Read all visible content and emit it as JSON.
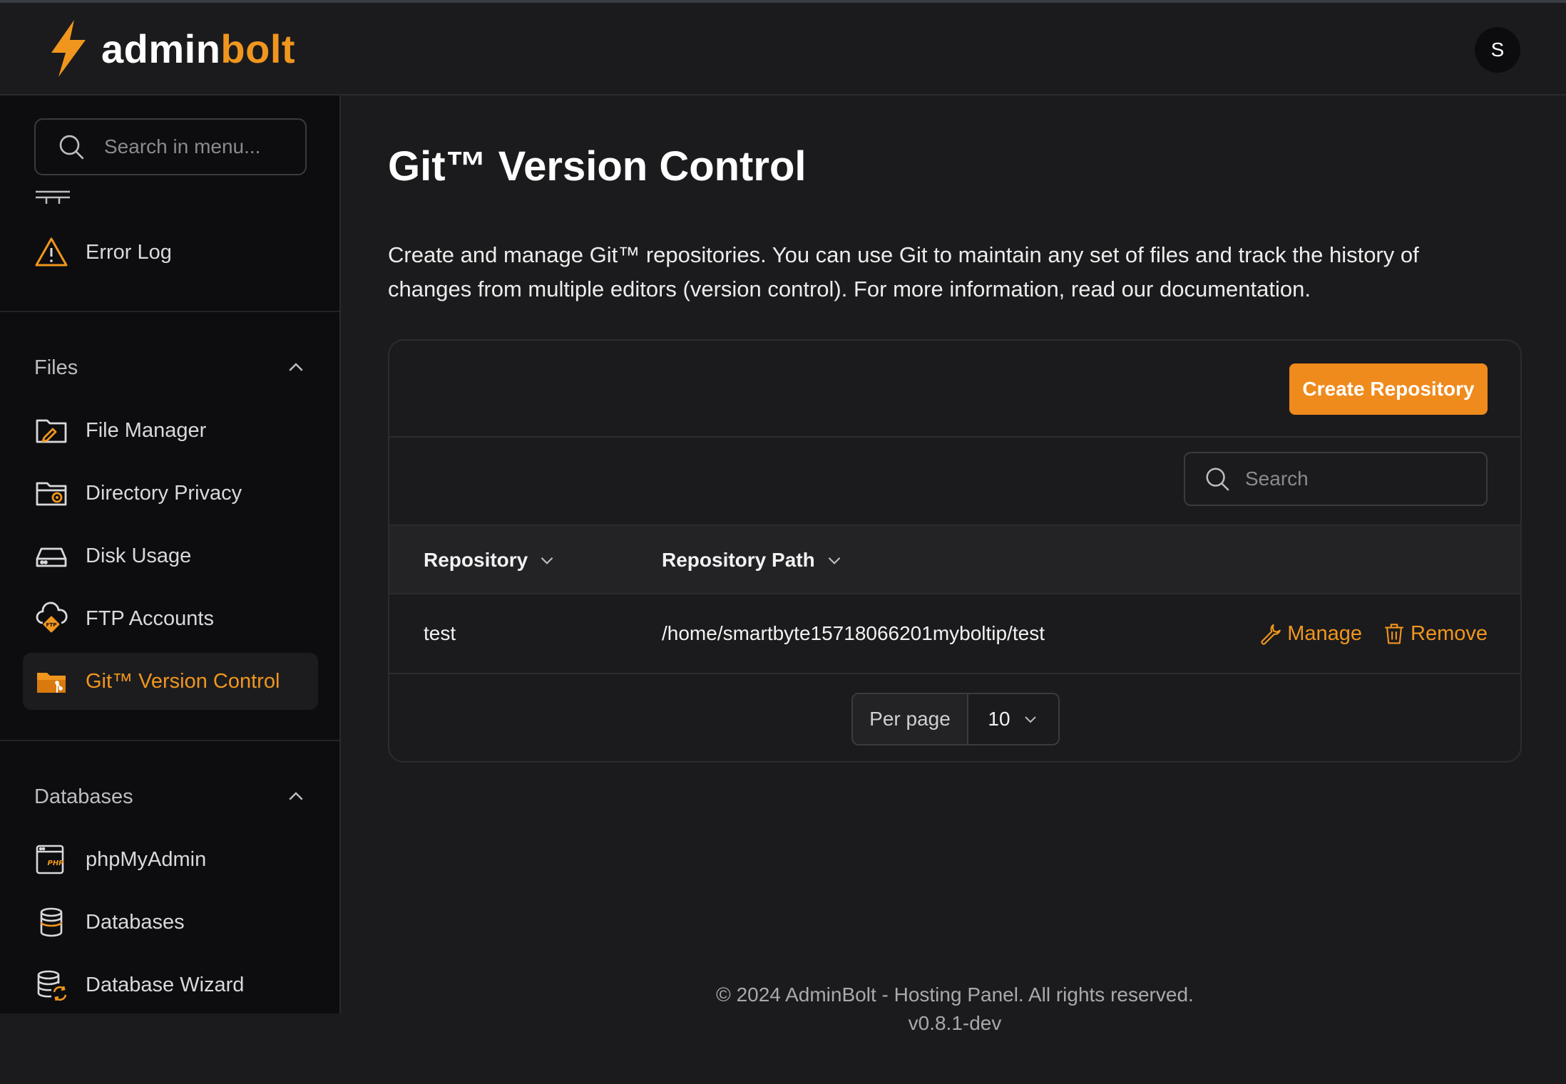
{
  "header": {
    "logo_part1": "admin",
    "logo_part2": "bolt",
    "avatar_initial": "S",
    "brand_color": "#f0961e"
  },
  "sidebar": {
    "search_placeholder": "Search in menu...",
    "top_items": [
      {
        "label": "Error Log",
        "icon": "warning-icon"
      }
    ],
    "sections": [
      {
        "title": "Files",
        "expanded": true,
        "items": [
          {
            "label": "File Manager",
            "icon": "file-manager-icon"
          },
          {
            "label": "Directory Privacy",
            "icon": "directory-privacy-icon"
          },
          {
            "label": "Disk Usage",
            "icon": "disk-usage-icon"
          },
          {
            "label": "FTP Accounts",
            "icon": "ftp-accounts-icon"
          },
          {
            "label": "Git™ Version Control",
            "icon": "git-folder-icon",
            "active": true
          }
        ]
      },
      {
        "title": "Databases",
        "expanded": true,
        "items": [
          {
            "label": "phpMyAdmin",
            "icon": "phpmyadmin-icon"
          },
          {
            "label": "Databases",
            "icon": "database-icon"
          },
          {
            "label": "Database Wizard",
            "icon": "database-wizard-icon"
          }
        ]
      }
    ]
  },
  "main": {
    "title": "Git™ Version Control",
    "description": "Create and manage Git™ repositories. You can use Git to maintain any set of files and track the history of changes from multiple editors (version control). For more information, read our documentation.",
    "create_button": "Create Repository",
    "search_placeholder": "Search",
    "table": {
      "columns": [
        "Repository",
        "Repository Path"
      ],
      "rows": [
        {
          "repository": "test",
          "path": "/home/smartbyte15718066201myboltip/test"
        }
      ],
      "actions": {
        "manage": "Manage",
        "remove": "Remove"
      }
    },
    "pagination": {
      "label": "Per page",
      "value": "10"
    }
  },
  "footer": {
    "copyright": "© 2024 AdminBolt - Hosting Panel. All rights reserved.",
    "version": "v0.8.1-dev"
  }
}
